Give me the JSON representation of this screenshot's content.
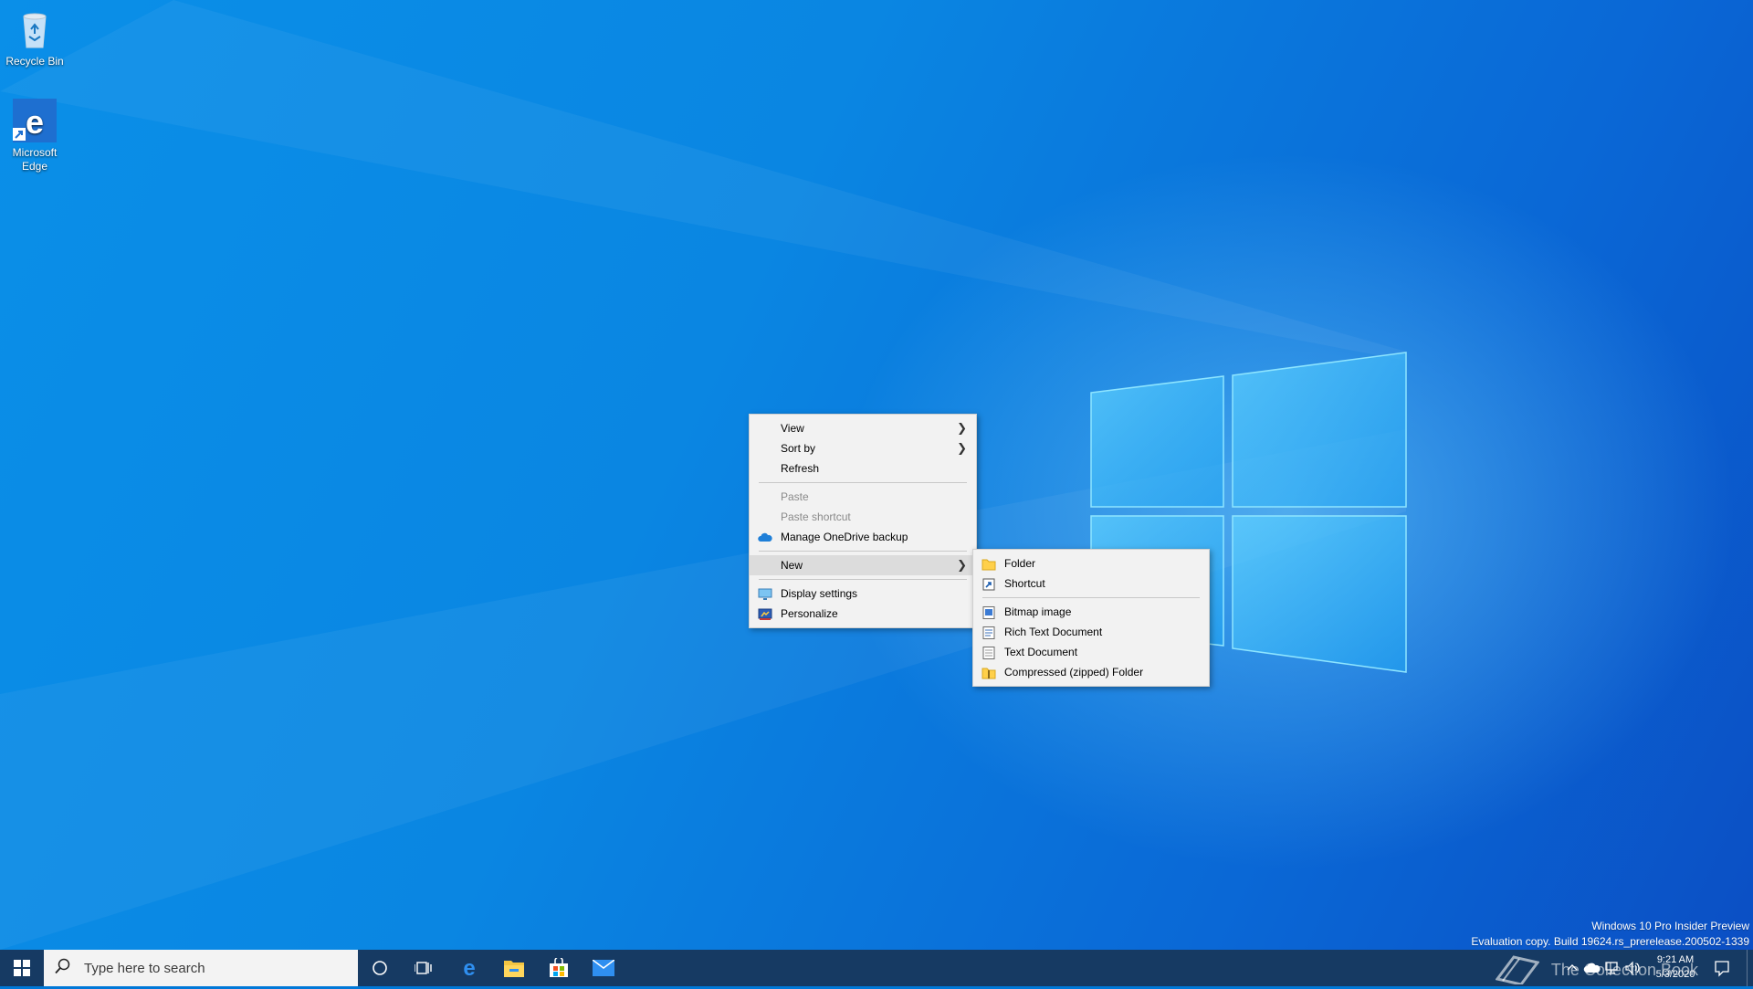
{
  "desktop": {
    "icons": [
      {
        "label": "Recycle Bin",
        "icon": "recycle-bin-icon"
      },
      {
        "label": "Microsoft Edge",
        "icon": "edge-icon"
      }
    ]
  },
  "context_menu": {
    "items": [
      {
        "label": "View",
        "has_submenu": true
      },
      {
        "label": "Sort by",
        "has_submenu": true
      },
      {
        "label": "Refresh"
      },
      {
        "label": "Paste",
        "disabled": true
      },
      {
        "label": "Paste shortcut",
        "disabled": true
      },
      {
        "label": "Manage OneDrive backup",
        "icon": "onedrive-icon"
      },
      {
        "label": "New",
        "has_submenu": true,
        "highlighted": true
      },
      {
        "label": "Display settings",
        "icon": "display-settings-icon"
      },
      {
        "label": "Personalize",
        "icon": "personalize-icon"
      }
    ]
  },
  "new_submenu": {
    "items": [
      {
        "label": "Folder",
        "icon": "folder-icon"
      },
      {
        "label": "Shortcut",
        "icon": "shortcut-icon"
      },
      {
        "label": "Bitmap image",
        "icon": "bitmap-icon"
      },
      {
        "label": "Rich Text Document",
        "icon": "rich-text-icon"
      },
      {
        "label": "Text Document",
        "icon": "text-document-icon"
      },
      {
        "label": "Compressed (zipped) Folder",
        "icon": "zip-folder-icon"
      }
    ]
  },
  "watermark": {
    "line1": "Windows 10 Pro Insider Preview",
    "line2": "Evaluation copy. Build 19624.rs_prerelease.200502-1339"
  },
  "taskbar": {
    "search_placeholder": "Type here to search",
    "pinned": [
      "cortana-icon",
      "task-view-icon",
      "edge-icon",
      "file-explorer-icon",
      "store-icon",
      "mail-icon"
    ],
    "clock_time": "9:21 AM",
    "clock_date": "5/3/2020",
    "overlay_text": "The Collection Book"
  },
  "colors": {
    "accent": "#0078d7",
    "taskbar": "#163a63",
    "menu_bg": "#f2f2f2"
  }
}
